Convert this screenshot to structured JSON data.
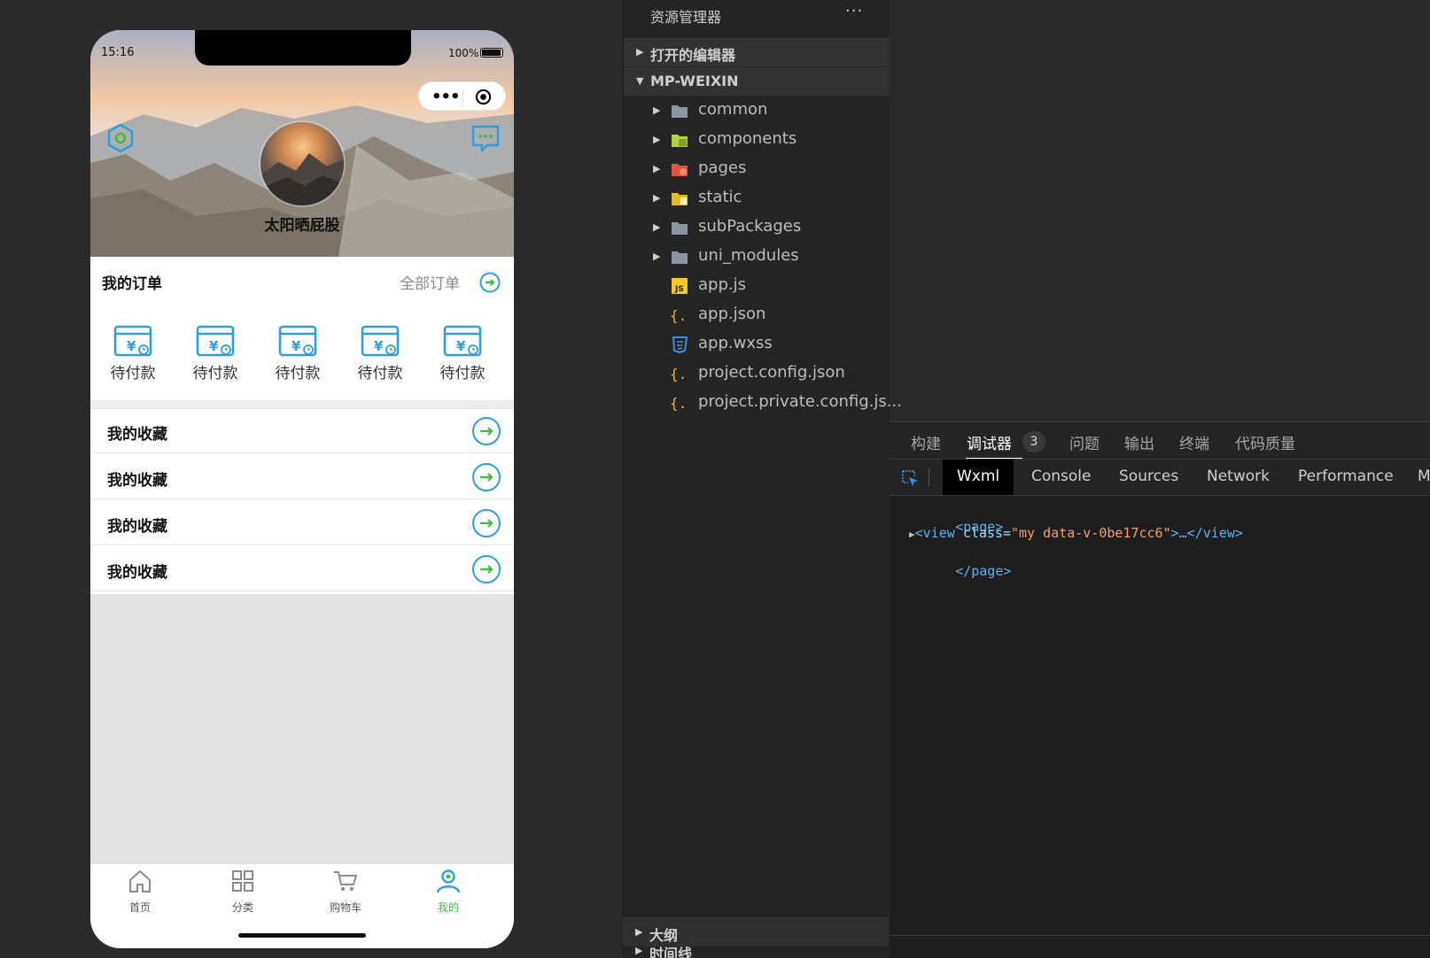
{
  "phone": {
    "status": {
      "time": "15:16",
      "battery": "100%"
    },
    "nickname": "太阳晒屁股",
    "orders": {
      "title": "我的订单",
      "all_label": "全部订单",
      "items": [
        "待付款",
        "待付款",
        "待付款",
        "待付款",
        "待付款"
      ]
    },
    "favorites": [
      "我的收藏",
      "我的收藏",
      "我的收藏",
      "我的收藏"
    ],
    "tabbar": [
      {
        "label": "首页",
        "icon": "home-icon"
      },
      {
        "label": "分类",
        "icon": "grid-icon"
      },
      {
        "label": "购物车",
        "icon": "cart-icon"
      },
      {
        "label": "我的",
        "icon": "user-icon",
        "active": true
      }
    ],
    "colors": {
      "accent_blue": "#2b9fe0",
      "active_green": "#3bbf3a"
    }
  },
  "explorer": {
    "title": "资源管理器",
    "more": "···",
    "open_editors": "打开的编辑器",
    "project": "MP-WEIXIN",
    "tree": [
      {
        "name": "common",
        "type": "folder",
        "icon": "folder-icon"
      },
      {
        "name": "components",
        "type": "folder",
        "icon": "components-folder-icon"
      },
      {
        "name": "pages",
        "type": "folder",
        "icon": "pages-folder-icon"
      },
      {
        "name": "static",
        "type": "folder",
        "icon": "static-folder-icon"
      },
      {
        "name": "subPackages",
        "type": "folder",
        "icon": "folder-icon"
      },
      {
        "name": "uni_modules",
        "type": "folder",
        "icon": "folder-icon"
      },
      {
        "name": "app.js",
        "type": "file",
        "icon": "js-file-icon"
      },
      {
        "name": "app.json",
        "type": "file",
        "icon": "json-file-icon"
      },
      {
        "name": "app.wxss",
        "type": "file",
        "icon": "css-file-icon"
      },
      {
        "name": "project.config.json",
        "type": "file",
        "icon": "json-file-icon"
      },
      {
        "name": "project.private.config.js...",
        "type": "file",
        "icon": "json-file-icon"
      }
    ],
    "outline": "大纲",
    "timeline": "时间线"
  },
  "debugger": {
    "tabs": [
      "构建",
      "调试器",
      "问题",
      "输出",
      "终端",
      "代码质量"
    ],
    "badge": "3",
    "panels": [
      "Wxml",
      "Console",
      "Sources",
      "Network",
      "Performance",
      "M"
    ],
    "wxml": {
      "open_page": "<page>",
      "view_open": "<view ",
      "attr": "class=",
      "value": "\"my data-v-0be17cc6\"",
      "ellipsis": ">…</view>",
      "close_page": "</page>"
    }
  }
}
